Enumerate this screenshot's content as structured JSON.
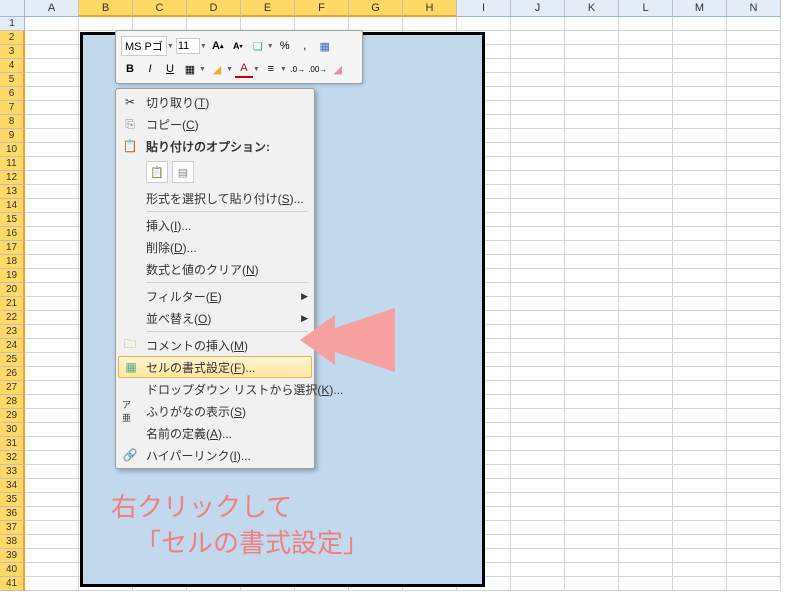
{
  "columns": [
    "A",
    "B",
    "C",
    "D",
    "E",
    "F",
    "G",
    "H",
    "I",
    "J",
    "K",
    "L",
    "M",
    "N"
  ],
  "selected_cols": [
    "B",
    "C",
    "D",
    "E",
    "F",
    "G",
    "H"
  ],
  "row_count": 41,
  "selected_rows_from": 2,
  "toolbar": {
    "font_name": "MS Pゴ",
    "font_size": "11",
    "increase_font": "A",
    "decrease_font": "A",
    "percent": "%",
    "comma": ",",
    "bold": "B",
    "italic": "I",
    "underline": "U",
    "inc_dec": ".0",
    "dec_inc": ".00"
  },
  "menu": {
    "cut": "切り取り(T)",
    "copy": "コピー(C)",
    "paste_options": "貼り付けのオプション:",
    "paste_special": "形式を選択して貼り付け(S)...",
    "insert": "挿入(I)...",
    "delete": "削除(D)...",
    "clear": "数式と値のクリア(N)",
    "filter": "フィルター(E)",
    "sort": "並べ替え(O)",
    "insert_comment": "コメントの挿入(M)",
    "format_cells": "セルの書式設定(F)...",
    "dropdown_select": "ドロップダウン リストから選択(K)...",
    "phonetic": "ふりがなの表示(S)",
    "define_name": "名前の定義(A)...",
    "hyperlink": "ハイパーリンク(I)..."
  },
  "caption": {
    "line1": "右クリックして",
    "line2": "「セルの書式設定」"
  }
}
